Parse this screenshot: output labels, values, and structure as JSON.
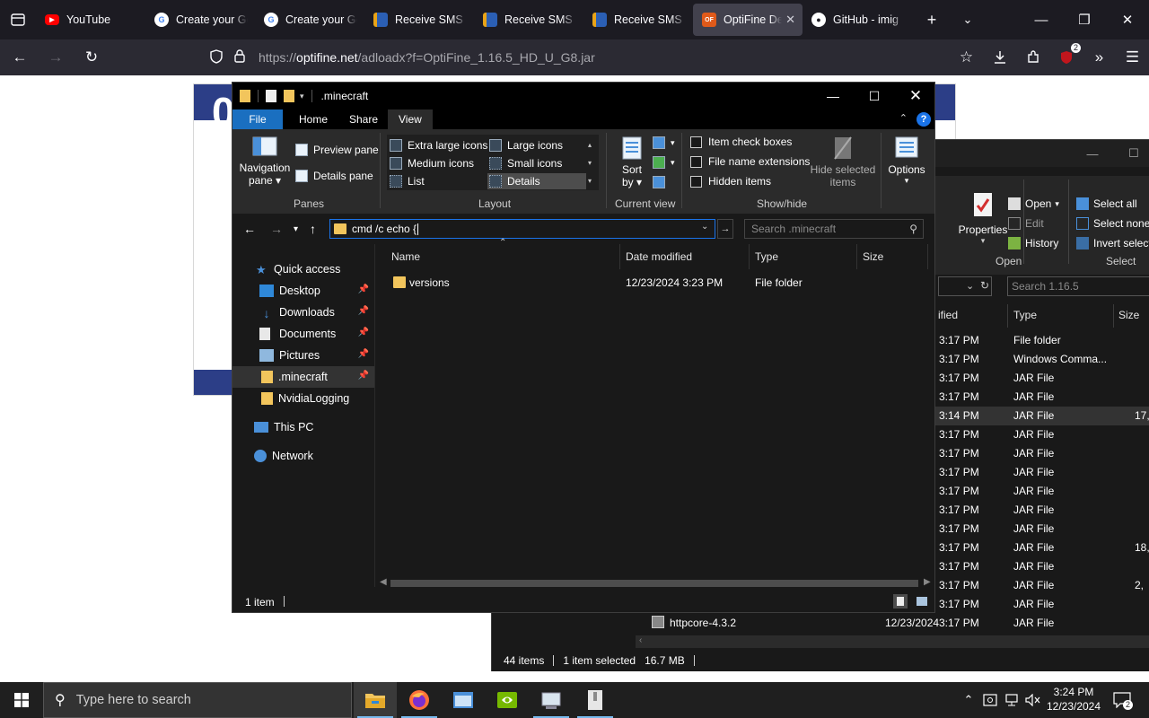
{
  "browser": {
    "tabs": [
      {
        "title": "YouTube",
        "favicon": "youtube-icon",
        "color": "#ff0000"
      },
      {
        "title": "Create your Go",
        "favicon": "google-icon",
        "color": "#ffffff"
      },
      {
        "title": "Create your Go",
        "favicon": "google-icon",
        "color": "#ffffff"
      },
      {
        "title": "Receive SMS o",
        "favicon": "sms-icon",
        "color": "#2b5fb4"
      },
      {
        "title": "Receive SMS o",
        "favicon": "sms-icon",
        "color": "#2b5fb4"
      },
      {
        "title": "Receive SMS o",
        "favicon": "sms-icon",
        "color": "#2b5fb4"
      },
      {
        "title": "OptiFine De",
        "favicon": "optifine-icon",
        "color": "#e05a1a",
        "active": true
      },
      {
        "title": "GitHub - imig",
        "favicon": "github-icon",
        "color": "#ffffff"
      }
    ],
    "url_prefix": "https://",
    "url_domain": "optifine.net",
    "url_path": "/adloadx?f=OptiFine_1.16.5_HD_U_G8.jar",
    "extensions_badge": "2"
  },
  "web": {
    "heading_fragment": "0"
  },
  "front_explorer": {
    "title": ".minecraft",
    "ribbon_tabs": [
      "File",
      "Home",
      "Share",
      "View"
    ],
    "active_tab": "View",
    "panes": {
      "navigation_pane": "Navigation",
      "navigation_pane_2": "pane",
      "preview_pane": "Preview pane",
      "details_pane": "Details pane",
      "label": "Panes"
    },
    "layout": {
      "extra_large_icons": "Extra large icons",
      "large_icons": "Large icons",
      "medium_icons": "Medium icons",
      "small_icons": "Small icons",
      "list": "List",
      "details": "Details",
      "label": "Layout"
    },
    "current_view": {
      "sort": "Sort",
      "by": "by",
      "label": "Current view"
    },
    "show_hide": {
      "item_check_boxes": "Item check boxes",
      "file_name_extensions": "File name extensions",
      "hidden_items": "Hidden items",
      "hide_selected": "Hide selected",
      "items": "items",
      "label": "Show/hide"
    },
    "options": "Options",
    "address": "cmd /c echo {",
    "search_placeholder": "Search .minecraft",
    "nav": {
      "quick_access": "Quick access",
      "desktop": "Desktop",
      "downloads": "Downloads",
      "documents": "Documents",
      "pictures": "Pictures",
      "minecraft": ".minecraft",
      "nvidia": "NvidiaLogging",
      "this_pc": "This PC",
      "network": "Network"
    },
    "columns": {
      "name": "Name",
      "date": "Date modified",
      "type": "Type",
      "size": "Size"
    },
    "files": [
      {
        "name": "versions",
        "date": "12/23/2024 3:23 PM",
        "type": "File folder",
        "size": ""
      }
    ],
    "status": "1 item"
  },
  "back_explorer": {
    "ribbon": {
      "properties": "Properties",
      "open": "Open",
      "edit": "Edit",
      "history": "History",
      "open_label": "Open",
      "select_all": "Select all",
      "select_none": "Select none",
      "invert_selection": "Invert selecti",
      "select_label": "Select"
    },
    "search_placeholder": "Search 1.16.5",
    "columns": {
      "date_frag": "ified",
      "type": "Type",
      "size": "Size"
    },
    "rows": [
      {
        "time": "3:17 PM",
        "type": "File folder",
        "size": ""
      },
      {
        "time": "3:17 PM",
        "type": "Windows Comma...",
        "size": ""
      },
      {
        "time": "3:17 PM",
        "type": "JAR File",
        "size": ""
      },
      {
        "time": "3:17 PM",
        "type": "JAR File",
        "size": ""
      },
      {
        "time": "3:14 PM",
        "type": "JAR File",
        "size": "17,",
        "selected": true
      },
      {
        "time": "3:17 PM",
        "type": "JAR File",
        "size": ""
      },
      {
        "time": "3:17 PM",
        "type": "JAR File",
        "size": ""
      },
      {
        "time": "3:17 PM",
        "type": "JAR File",
        "size": ""
      },
      {
        "time": "3:17 PM",
        "type": "JAR File",
        "size": ""
      },
      {
        "time": "3:17 PM",
        "type": "JAR File",
        "size": ""
      },
      {
        "time": "3:17 PM",
        "type": "JAR File",
        "size": ""
      },
      {
        "time": "3:17 PM",
        "type": "JAR File",
        "size": "18,"
      },
      {
        "time": "3:17 PM",
        "type": "JAR File",
        "size": ""
      },
      {
        "time": "3:17 PM",
        "type": "JAR File",
        "size": "2,"
      },
      {
        "time": "3:17 PM",
        "type": "JAR File",
        "size": ""
      }
    ],
    "last_row": {
      "name": "httpcore-4.3.2",
      "date": "12/23/2024",
      "time": "3:17 PM",
      "type": "JAR File"
    },
    "status": {
      "items": "44 items",
      "selected": "1 item selected",
      "size": "16.7 MB"
    }
  },
  "taskbar": {
    "search_placeholder": "Type here to search",
    "time": "3:24 PM",
    "date": "12/23/2024",
    "notifications": "2"
  }
}
